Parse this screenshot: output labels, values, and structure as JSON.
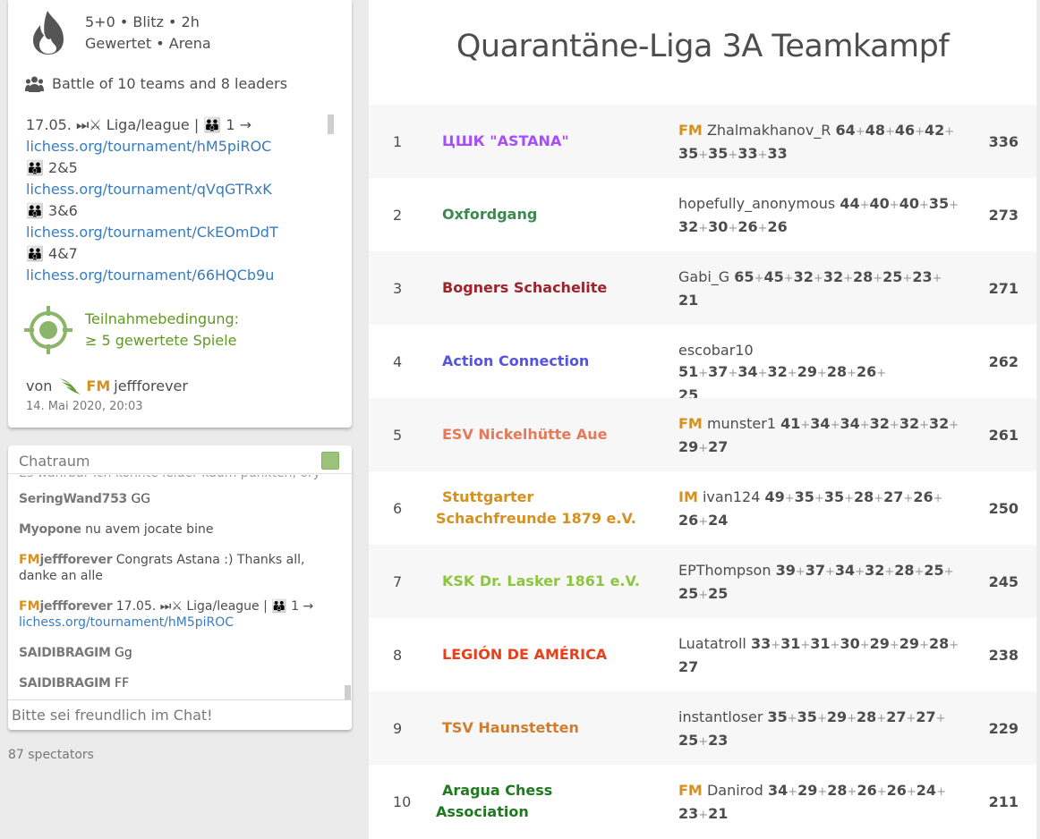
{
  "tournament": {
    "clock_line": "5+0 • Blitz • 2h",
    "mode_line": "Gewertet • Arena",
    "battle": "Battle of 10 teams and 8 leaders",
    "description": [
      {
        "text": "17.05. ⏭⚔ Liga/league | 👪 1 →",
        "link": false
      },
      {
        "text": "lichess.org/tournament/hM5piROC",
        "link": true
      },
      {
        "text": "👪 2&5",
        "link": false
      },
      {
        "text": "lichess.org/tournament/qVqGTRxK",
        "link": true
      },
      {
        "text": "👪 3&6",
        "link": false
      },
      {
        "text": "lichess.org/tournament/CkEOmDdT",
        "link": true
      },
      {
        "text": "👪 4&7",
        "link": false
      },
      {
        "text": "lichess.org/tournament/66HQCb9u",
        "link": true
      }
    ],
    "condition_line1": "Teilnahmebedingung:",
    "condition_line2": "≥ 5 gewertete Spiele",
    "by_label": "von",
    "creator_title": "FM",
    "creator": "jeffforever",
    "created_at": "14. Mai 2020, 20:03"
  },
  "chat": {
    "title": "Chatraum",
    "cut_line": "Es wahrbar ich konnte leider kaum punkten, ory",
    "messages": [
      {
        "title": "",
        "user": "SeringWand753",
        "text": "GG"
      },
      {
        "title": "",
        "user": "Myopone",
        "text": "nu avem jocate bine"
      },
      {
        "title": "FM",
        "user": "jeffforever",
        "text": "Congrats Astana :) Thanks all, danke an alle"
      },
      {
        "title": "FM",
        "user": "jeffforever",
        "text": "17.05. ⏭⚔ Liga/league | 👪 1 →",
        "link": "lichess.org/tournament/hM5piROC"
      },
      {
        "title": "",
        "user": "SAIDIBRAGIM",
        "text": "Gg"
      },
      {
        "title": "",
        "user": "SAIDIBRAGIM",
        "text": "FF"
      }
    ],
    "placeholder": "Bitte sei freundlich im Chat!"
  },
  "spectators": "87 spectators",
  "main": {
    "title": "Quarantäne-Liga 3A Teamkampf"
  },
  "colors": {
    "link": "#3a7bbd",
    "condition": "#629924",
    "fm_title": "#d59120"
  },
  "standings": [
    {
      "rank": "1",
      "team": [
        "ЦШК \"ASTANA\""
      ],
      "color": "#a64dff",
      "title": "FM",
      "leader": "Zhalmakhanov_R",
      "scores": [
        "64",
        "48",
        "46",
        "42",
        "35",
        "35",
        "33",
        "33"
      ],
      "break_after": 4,
      "total": "336"
    },
    {
      "rank": "2",
      "team": [
        "Oxfordgang"
      ],
      "color": "#3a8a4f",
      "title": "",
      "leader": "hopefully_anonymous",
      "scores": [
        "44",
        "40",
        "40",
        "35",
        "32",
        "30",
        "26",
        "26"
      ],
      "break_after": 4,
      "total": "273"
    },
    {
      "rank": "3",
      "team": [
        "Bogners Schachelite"
      ],
      "color": "#a0222b",
      "title": "",
      "leader": "Gabi_G",
      "scores": [
        "65",
        "45",
        "32",
        "32",
        "28",
        "25",
        "23",
        "21"
      ],
      "break_after": 7,
      "total": "271"
    },
    {
      "rank": "4",
      "team": [
        "Action Connection"
      ],
      "color": "#5454e0",
      "title": "",
      "leader": "escobar10",
      "scores": [
        "51",
        "37",
        "34",
        "32",
        "29",
        "28",
        "26",
        "25"
      ],
      "break_after": 7,
      "total": "262"
    },
    {
      "rank": "5",
      "team": [
        "ESV Nickelhütte Aue"
      ],
      "color": "#e57a5a",
      "title": "FM",
      "leader": "munster1",
      "scores": [
        "41",
        "34",
        "34",
        "32",
        "32",
        "32",
        "29",
        "27"
      ],
      "break_after": 6,
      "total": "261"
    },
    {
      "rank": "6",
      "team": [
        "Stuttgarter",
        "Schachfreunde 1879 e.V."
      ],
      "color": "#d59120",
      "title": "IM",
      "leader": "ivan124",
      "scores": [
        "49",
        "35",
        "35",
        "28",
        "27",
        "26",
        "26",
        "24"
      ],
      "break_after": 6,
      "total": "250"
    },
    {
      "rank": "7",
      "team": [
        "KSK Dr. Lasker 1861 e.V."
      ],
      "color": "#8cc63f",
      "title": "",
      "leader": "EPThompson",
      "scores": [
        "39",
        "37",
        "34",
        "32",
        "28",
        "25",
        "25",
        "25"
      ],
      "break_after": 6,
      "total": "245"
    },
    {
      "rank": "8",
      "team": [
        "LEGIÓN DE AMÉRICA"
      ],
      "color": "#e8401c",
      "title": "",
      "leader": "Luatatroll",
      "scores": [
        "33",
        "31",
        "31",
        "30",
        "29",
        "29",
        "28",
        "27"
      ],
      "break_after": 7,
      "total": "238"
    },
    {
      "rank": "9",
      "team": [
        "TSV Haunstetten"
      ],
      "color": "#d27d2d",
      "title": "",
      "leader": "instantloser",
      "scores": [
        "35",
        "35",
        "29",
        "28",
        "27",
        "27",
        "25",
        "23"
      ],
      "break_after": 6,
      "total": "229"
    },
    {
      "rank": "10",
      "team": [
        "Aragua Chess",
        "Association"
      ],
      "color": "#1f7a1f",
      "title": "FM",
      "leader": "Danirod",
      "scores": [
        "34",
        "29",
        "28",
        "26",
        "26",
        "24",
        "23",
        "21"
      ],
      "break_after": 6,
      "total": "211"
    }
  ]
}
